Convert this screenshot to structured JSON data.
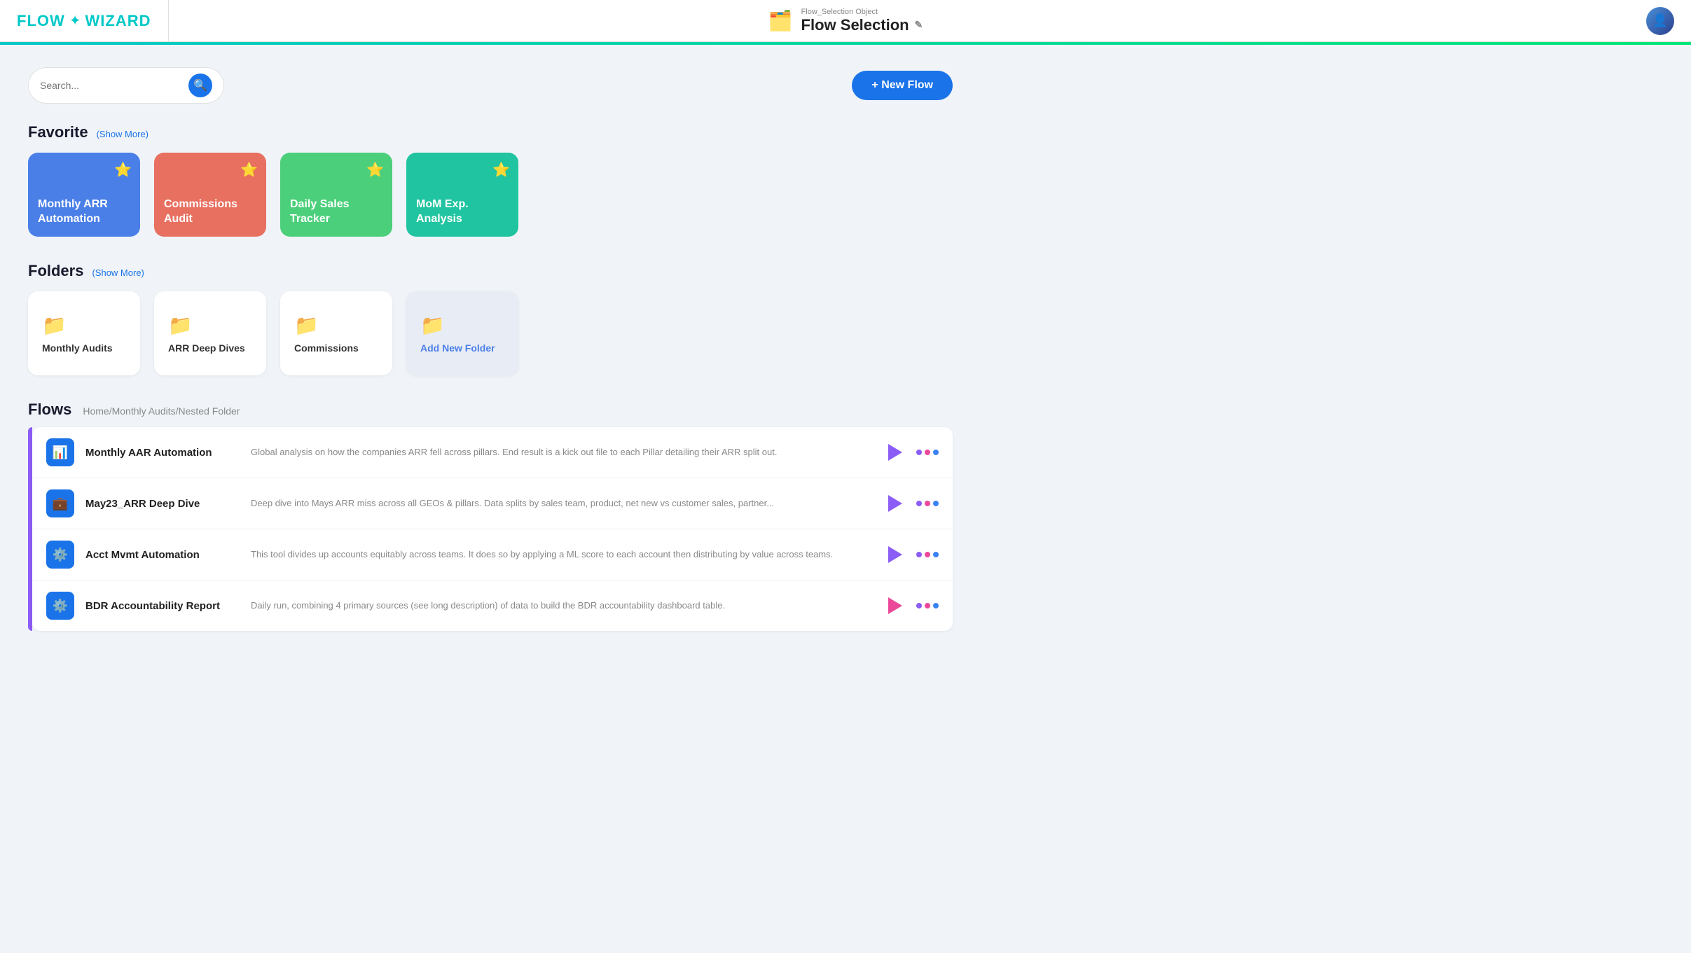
{
  "header": {
    "logo_flow": "FLOW",
    "logo_wizard": "WIZARD",
    "object_type": "Flow_Selection Object",
    "title": "Flow Selection",
    "edit_icon": "✎"
  },
  "search": {
    "placeholder": "Search..."
  },
  "new_flow_button": "+ New Flow",
  "sections": {
    "favorites": {
      "title": "Favorite",
      "show_more": "(Show More)",
      "cards": [
        {
          "label": "Monthly ARR Automation",
          "color": "fav-blue"
        },
        {
          "label": "Commissions Audit",
          "color": "fav-coral"
        },
        {
          "label": "Daily Sales Tracker",
          "color": "fav-green"
        },
        {
          "label": "MoM Exp. Analysis",
          "color": "fav-teal"
        }
      ]
    },
    "folders": {
      "title": "Folders",
      "show_more": "(Show More)",
      "items": [
        {
          "name": "Monthly Audits"
        },
        {
          "name": "ARR Deep Dives"
        },
        {
          "name": "Commissions"
        },
        {
          "name": "Add New Folder",
          "is_add": true
        }
      ]
    },
    "flows": {
      "title": "Flows",
      "breadcrumb": "Home/Monthly Audits/Nested Folder",
      "items": [
        {
          "name": "Monthly AAR Automation",
          "icon": "📊",
          "description": "Global analysis on how the companies ARR fell across pillars. End result is a kick out file to each Pillar detailing their ARR split out."
        },
        {
          "name": "May23_ARR Deep Dive",
          "icon": "💼",
          "description": "Deep dive into Mays ARR miss across all GEOs & pillars. Data splits by sales team, product, net new vs customer sales, partner..."
        },
        {
          "name": "Acct Mvmt Automation",
          "icon": "⚙️",
          "description": "This tool divides up accounts equitably across teams. It does so by applying a ML score to each account then distributing by value across teams."
        },
        {
          "name": "BDR Accountability Report",
          "icon": "⚙️",
          "description": "Daily run, combining 4 primary sources (see long description) of data to build the BDR accountability dashboard table."
        }
      ]
    }
  }
}
